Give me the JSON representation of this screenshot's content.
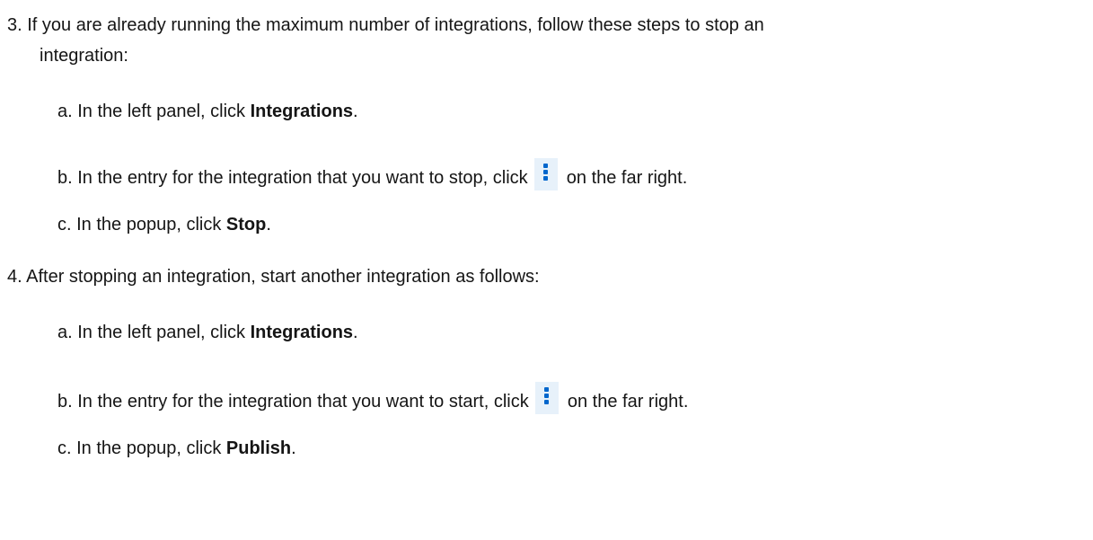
{
  "steps": [
    {
      "number": "3.",
      "intro_line1": "If you are already running the maximum number of integrations, follow these steps to stop an",
      "intro_line2": "integration:",
      "substeps": [
        {
          "marker": "a.",
          "prefix": "In the left panel, click ",
          "bold": "Integrations",
          "suffix": "."
        },
        {
          "marker": "b.",
          "prefix": "In the entry for the integration that you want to stop, click",
          "icon": "kebab-menu-icon",
          "suffix": "on the far right."
        },
        {
          "marker": "c.",
          "prefix": "In the popup, click ",
          "bold": "Stop",
          "suffix": "."
        }
      ]
    },
    {
      "number": "4.",
      "intro_line1": "After stopping an integration, start another integration as follows:",
      "substeps": [
        {
          "marker": "a.",
          "prefix": "In the left panel, click ",
          "bold": "Integrations",
          "suffix": "."
        },
        {
          "marker": "b.",
          "prefix": "In the entry for the integration that you want to start, click",
          "icon": "kebab-menu-icon",
          "suffix": "on the far right."
        },
        {
          "marker": "c.",
          "prefix": "In the popup, click ",
          "bold": "Publish",
          "suffix": "."
        }
      ]
    }
  ],
  "colors": {
    "text": "#151515",
    "icon_background": "#e7f1fa",
    "icon_dots": "#0066cc"
  }
}
